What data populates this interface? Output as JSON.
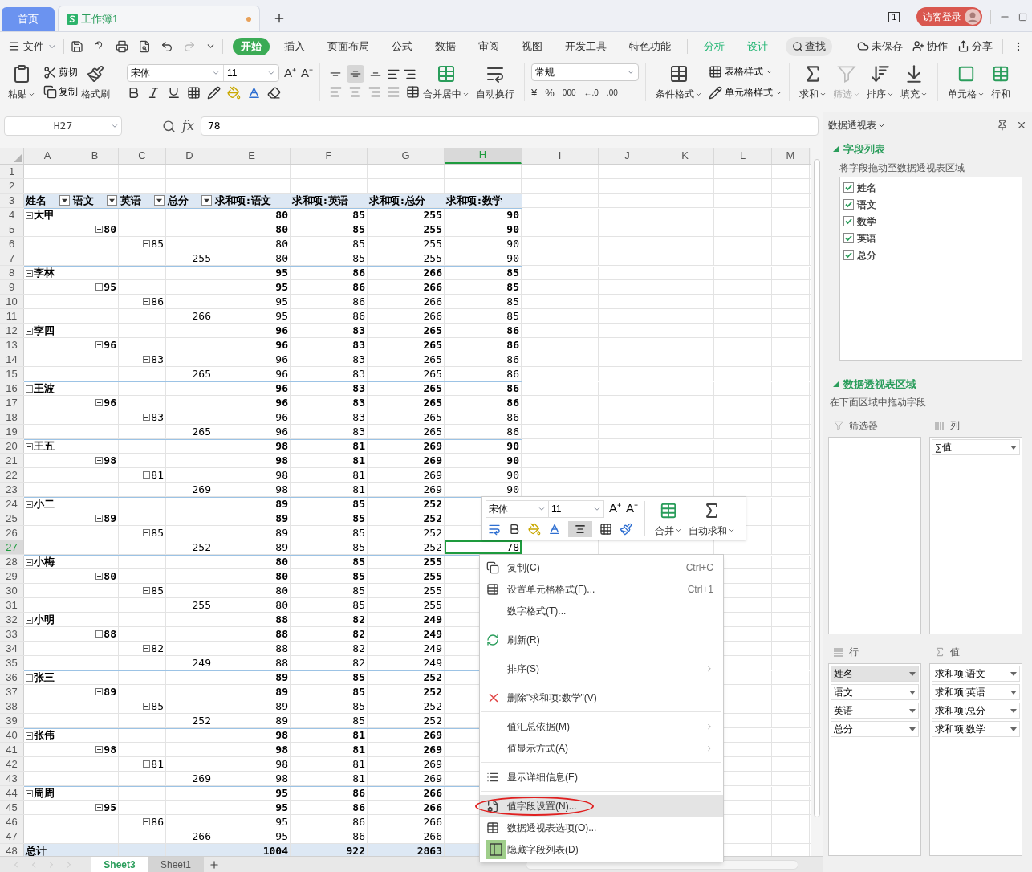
{
  "title_bar": {
    "tabs": [
      {
        "label": "首页",
        "kind": "home",
        "selected": false
      },
      {
        "label": "工作簿1",
        "kind": "sheet",
        "selected": true,
        "unsaved": true
      }
    ],
    "page_count": "1",
    "login": "访客登录"
  },
  "menu": {
    "file": "文件",
    "tabs": [
      {
        "label": "开始",
        "selected": true,
        "contextual": false
      },
      {
        "label": "插入",
        "selected": false,
        "contextual": false
      },
      {
        "label": "页面布局",
        "selected": false,
        "contextual": false
      },
      {
        "label": "公式",
        "selected": false,
        "contextual": false
      },
      {
        "label": "数据",
        "selected": false,
        "contextual": false
      },
      {
        "label": "审阅",
        "selected": false,
        "contextual": false
      },
      {
        "label": "视图",
        "selected": false,
        "contextual": false
      },
      {
        "label": "开发工具",
        "selected": false,
        "contextual": false
      },
      {
        "label": "特色功能",
        "selected": false,
        "contextual": false
      },
      {
        "label": "分析",
        "selected": false,
        "contextual": true
      },
      {
        "label": "设计",
        "selected": false,
        "contextual": true
      }
    ],
    "search": "查找",
    "actions": [
      "未保存",
      "协作",
      "分享"
    ]
  },
  "ribbon": {
    "paste": "粘贴",
    "cut": "剪切",
    "copy": "复制",
    "format_painter": "格式刷",
    "font": "宋体",
    "font_size": "11",
    "font_buttons": [
      "A⁺",
      "A⁻"
    ],
    "vertical_align": [
      {
        "selected": false
      },
      {
        "selected": true
      },
      {
        "selected": false
      }
    ],
    "merge": "合并居中",
    "wrap": "自动换行",
    "number_format": "常规",
    "number_buttons": [
      "¥",
      "%",
      "000",
      "←.0",
      ".00"
    ],
    "conditional": "条件格式",
    "table_style": "表格样式",
    "cell_style": "单元格样式",
    "tools": [
      {
        "label": "求和",
        "kind": "sum",
        "disabled": false
      },
      {
        "label": "筛选",
        "kind": "filter",
        "disabled": true
      },
      {
        "label": "排序",
        "kind": "sort",
        "disabled": false
      },
      {
        "label": "填充",
        "kind": "fill",
        "disabled": false
      }
    ],
    "cells": "单元格",
    "rows_cols": "行和"
  },
  "formula_bar": {
    "name_box": "H27",
    "fx": "fx",
    "value": "78"
  },
  "sheet": {
    "columns": [
      {
        "label": "A",
        "selected": false
      },
      {
        "label": "B",
        "selected": false
      },
      {
        "label": "C",
        "selected": false
      },
      {
        "label": "D",
        "selected": false
      },
      {
        "label": "E",
        "selected": false
      },
      {
        "label": "F",
        "selected": false
      },
      {
        "label": "G",
        "selected": false
      },
      {
        "label": "H",
        "selected": true
      },
      {
        "label": "I",
        "selected": false
      },
      {
        "label": "J",
        "selected": false
      },
      {
        "label": "K",
        "selected": false
      },
      {
        "label": "L",
        "selected": false
      },
      {
        "label": "M",
        "selected": false
      }
    ],
    "rows": [
      {
        "number": "1",
        "selected": false,
        "kind": "blank"
      },
      {
        "number": "2",
        "selected": false,
        "kind": "blank"
      },
      {
        "number": "3",
        "selected": false,
        "kind": "header",
        "fields": [
          "姓名",
          "语文",
          "英语",
          "总分"
        ],
        "values": [
          "求和项:语文",
          "求和项:英语",
          "求和项:总分",
          "求和项:数学"
        ]
      },
      {
        "number": "4",
        "selected": false,
        "kind": "name",
        "label": "大甲",
        "expanded": true,
        "values": [
          "80",
          "85",
          "255",
          "90"
        ]
      },
      {
        "number": "5",
        "selected": false,
        "kind": "chinese",
        "label": "80",
        "expanded": true,
        "values": [
          "80",
          "85",
          "255",
          "90"
        ]
      },
      {
        "number": "6",
        "selected": false,
        "kind": "english",
        "label": "85",
        "expanded": true,
        "values": [
          "80",
          "85",
          "255",
          "90"
        ]
      },
      {
        "number": "7",
        "selected": false,
        "kind": "total",
        "label": "255",
        "values": [
          "80",
          "85",
          "255",
          "90"
        ]
      },
      {
        "number": "8",
        "selected": false,
        "kind": "name",
        "label": "李林",
        "expanded": true,
        "values": [
          "95",
          "86",
          "266",
          "85"
        ]
      },
      {
        "number": "9",
        "selected": false,
        "kind": "chinese",
        "label": "95",
        "expanded": true,
        "values": [
          "95",
          "86",
          "266",
          "85"
        ]
      },
      {
        "number": "10",
        "selected": false,
        "kind": "english",
        "label": "86",
        "expanded": true,
        "values": [
          "95",
          "86",
          "266",
          "85"
        ]
      },
      {
        "number": "11",
        "selected": false,
        "kind": "total",
        "label": "266",
        "values": [
          "95",
          "86",
          "266",
          "85"
        ]
      },
      {
        "number": "12",
        "selected": false,
        "kind": "name",
        "label": "李四",
        "expanded": true,
        "values": [
          "96",
          "83",
          "265",
          "86"
        ]
      },
      {
        "number": "13",
        "selected": false,
        "kind": "chinese",
        "label": "96",
        "expanded": true,
        "values": [
          "96",
          "83",
          "265",
          "86"
        ]
      },
      {
        "number": "14",
        "selected": false,
        "kind": "english",
        "label": "83",
        "expanded": true,
        "values": [
          "96",
          "83",
          "265",
          "86"
        ]
      },
      {
        "number": "15",
        "selected": false,
        "kind": "total",
        "label": "265",
        "values": [
          "96",
          "83",
          "265",
          "86"
        ]
      },
      {
        "number": "16",
        "selected": false,
        "kind": "name",
        "label": "王波",
        "expanded": true,
        "values": [
          "96",
          "83",
          "265",
          "86"
        ]
      },
      {
        "number": "17",
        "selected": false,
        "kind": "chinese",
        "label": "96",
        "expanded": true,
        "values": [
          "96",
          "83",
          "265",
          "86"
        ]
      },
      {
        "number": "18",
        "selected": false,
        "kind": "english",
        "label": "83",
        "expanded": true,
        "values": [
          "96",
          "83",
          "265",
          "86"
        ]
      },
      {
        "number": "19",
        "selected": false,
        "kind": "total",
        "label": "265",
        "values": [
          "96",
          "83",
          "265",
          "86"
        ]
      },
      {
        "number": "20",
        "selected": false,
        "kind": "name",
        "label": "王五",
        "expanded": true,
        "values": [
          "98",
          "81",
          "269",
          "90"
        ]
      },
      {
        "number": "21",
        "selected": false,
        "kind": "chinese",
        "label": "98",
        "expanded": true,
        "values": [
          "98",
          "81",
          "269",
          "90"
        ]
      },
      {
        "number": "22",
        "selected": false,
        "kind": "english",
        "label": "81",
        "expanded": true,
        "values": [
          "98",
          "81",
          "269",
          "90"
        ]
      },
      {
        "number": "23",
        "selected": false,
        "kind": "total",
        "label": "269",
        "values": [
          "98",
          "81",
          "269",
          "90"
        ]
      },
      {
        "number": "24",
        "selected": false,
        "kind": "name",
        "label": "小二",
        "expanded": true,
        "values": [
          "89",
          "85",
          "252"
        ]
      },
      {
        "number": "25",
        "selected": false,
        "kind": "chinese",
        "label": "89",
        "expanded": true,
        "values": [
          "89",
          "85",
          "252"
        ]
      },
      {
        "number": "26",
        "selected": false,
        "kind": "english",
        "label": "85",
        "expanded": true,
        "values": [
          "89",
          "85",
          "252"
        ]
      },
      {
        "number": "27",
        "selected": true,
        "kind": "total",
        "label": "252",
        "values": [
          "89",
          "85",
          "252",
          "78"
        ]
      },
      {
        "number": "28",
        "selected": false,
        "kind": "name",
        "label": "小梅",
        "expanded": true,
        "values": [
          "80",
          "85",
          "255"
        ]
      },
      {
        "number": "29",
        "selected": false,
        "kind": "chinese",
        "label": "80",
        "expanded": true,
        "values": [
          "80",
          "85",
          "255"
        ]
      },
      {
        "number": "30",
        "selected": false,
        "kind": "english",
        "label": "85",
        "expanded": true,
        "values": [
          "80",
          "85",
          "255"
        ]
      },
      {
        "number": "31",
        "selected": false,
        "kind": "total",
        "label": "255",
        "values": [
          "80",
          "85",
          "255"
        ]
      },
      {
        "number": "32",
        "selected": false,
        "kind": "name",
        "label": "小明",
        "expanded": true,
        "values": [
          "88",
          "82",
          "249"
        ]
      },
      {
        "number": "33",
        "selected": false,
        "kind": "chinese",
        "label": "88",
        "expanded": true,
        "values": [
          "88",
          "82",
          "249"
        ]
      },
      {
        "number": "34",
        "selected": false,
        "kind": "english",
        "label": "82",
        "expanded": true,
        "values": [
          "88",
          "82",
          "249"
        ]
      },
      {
        "number": "35",
        "selected": false,
        "kind": "total",
        "label": "249",
        "values": [
          "88",
          "82",
          "249"
        ]
      },
      {
        "number": "36",
        "selected": false,
        "kind": "name",
        "label": "张三",
        "expanded": true,
        "values": [
          "89",
          "85",
          "252"
        ]
      },
      {
        "number": "37",
        "selected": false,
        "kind": "chinese",
        "label": "89",
        "expanded": true,
        "values": [
          "89",
          "85",
          "252"
        ]
      },
      {
        "number": "38",
        "selected": false,
        "kind": "english",
        "label": "85",
        "expanded": true,
        "values": [
          "89",
          "85",
          "252"
        ]
      },
      {
        "number": "39",
        "selected": false,
        "kind": "total",
        "label": "252",
        "values": [
          "89",
          "85",
          "252"
        ]
      },
      {
        "number": "40",
        "selected": false,
        "kind": "name",
        "label": "张伟",
        "expanded": true,
        "values": [
          "98",
          "81",
          "269"
        ]
      },
      {
        "number": "41",
        "selected": false,
        "kind": "chinese",
        "label": "98",
        "expanded": true,
        "values": [
          "98",
          "81",
          "269"
        ]
      },
      {
        "number": "42",
        "selected": false,
        "kind": "english",
        "label": "81",
        "expanded": true,
        "values": [
          "98",
          "81",
          "269"
        ]
      },
      {
        "number": "43",
        "selected": false,
        "kind": "total",
        "label": "269",
        "values": [
          "98",
          "81",
          "269"
        ]
      },
      {
        "number": "44",
        "selected": false,
        "kind": "name",
        "label": "周周",
        "expanded": true,
        "values": [
          "95",
          "86",
          "266"
        ]
      },
      {
        "number": "45",
        "selected": false,
        "kind": "chinese",
        "label": "95",
        "expanded": true,
        "values": [
          "95",
          "86",
          "266"
        ]
      },
      {
        "number": "46",
        "selected": false,
        "kind": "english",
        "label": "86",
        "expanded": true,
        "values": [
          "95",
          "86",
          "266"
        ]
      },
      {
        "number": "47",
        "selected": false,
        "kind": "total",
        "label": "266",
        "values": [
          "95",
          "86",
          "266"
        ]
      },
      {
        "number": "48",
        "selected": false,
        "kind": "grand",
        "label": "总计",
        "values": [
          "1004",
          "922",
          "2863"
        ]
      }
    ]
  },
  "sheet_tabs": [
    {
      "label": "Sheet3",
      "selected": true
    },
    {
      "label": "Sheet1",
      "selected": false
    }
  ],
  "mini_toolbar": {
    "font": "宋体",
    "size": "11",
    "font_buttons": [
      "A⁺",
      "A⁻"
    ],
    "merge": "合并",
    "autosum": "自动求和"
  },
  "context_menu": [
    {
      "kind": "copy",
      "label": "复制(C)",
      "shortcut": "Ctrl+C",
      "submenu": false,
      "highlighted": false,
      "circled": false
    },
    {
      "kind": "format",
      "label": "设置单元格格式(F)...",
      "shortcut": "Ctrl+1",
      "submenu": false,
      "highlighted": false,
      "circled": false
    },
    {
      "kind": "plain",
      "label": "数字格式(T)...",
      "submenu": false,
      "highlighted": false,
      "circled": false
    },
    {
      "kind": "separator"
    },
    {
      "kind": "refresh",
      "label": "刷新(R)",
      "submenu": false,
      "highlighted": false,
      "circled": false
    },
    {
      "kind": "separator"
    },
    {
      "kind": "plain",
      "label": "排序(S)",
      "submenu": true,
      "highlighted": false,
      "circled": false
    },
    {
      "kind": "separator"
    },
    {
      "kind": "delete",
      "label": "删除\"求和项:数学\"(V)",
      "submenu": false,
      "highlighted": false,
      "circled": false
    },
    {
      "kind": "separator"
    },
    {
      "kind": "plain",
      "label": "值汇总依据(M)",
      "submenu": true,
      "highlighted": false,
      "circled": false
    },
    {
      "kind": "plain",
      "label": "值显示方式(A)",
      "submenu": true,
      "highlighted": false,
      "circled": false
    },
    {
      "kind": "separator"
    },
    {
      "kind": "details",
      "label": "显示详细信息(E)",
      "submenu": false,
      "highlighted": false,
      "circled": false
    },
    {
      "kind": "separator"
    },
    {
      "kind": "settings",
      "label": "值字段设置(N)...",
      "submenu": false,
      "highlighted": true,
      "circled": true
    },
    {
      "kind": "options",
      "label": "数据透视表选项(O)...",
      "submenu": false,
      "highlighted": false,
      "circled": false
    },
    {
      "kind": "panel",
      "label": "隐藏字段列表(D)",
      "submenu": false,
      "highlighted": false,
      "circled": false
    }
  ],
  "pivot_panel": {
    "title": "数据透视表",
    "field_section": "字段列表",
    "field_hint": "将字段拖动至数据透视表区域",
    "fields": [
      {
        "label": "姓名",
        "checked": true
      },
      {
        "label": "语文",
        "checked": true
      },
      {
        "label": "数学",
        "checked": true
      },
      {
        "label": "英语",
        "checked": true
      },
      {
        "label": "总分",
        "checked": true
      }
    ],
    "area_section": "数据透视表区域",
    "area_hint": "在下面区域中拖动字段",
    "areas": [
      {
        "kind": "filter",
        "label": "筛选器"
      },
      {
        "kind": "columns",
        "label": "列",
        "items": [
          {
            "label": "∑值",
            "selected": false
          }
        ]
      },
      {
        "kind": "rows",
        "label": "行",
        "items": [
          {
            "label": "姓名",
            "selected": true
          },
          {
            "label": "语文",
            "selected": false
          },
          {
            "label": "英语",
            "selected": false
          },
          {
            "label": "总分",
            "selected": false
          }
        ]
      },
      {
        "kind": "values",
        "label": "值",
        "items": [
          {
            "label": "求和项:语文",
            "selected": false
          },
          {
            "label": "求和项:英语",
            "selected": false
          },
          {
            "label": "求和项:总分",
            "selected": false
          },
          {
            "label": "求和项:数学",
            "selected": false
          }
        ]
      }
    ]
  }
}
